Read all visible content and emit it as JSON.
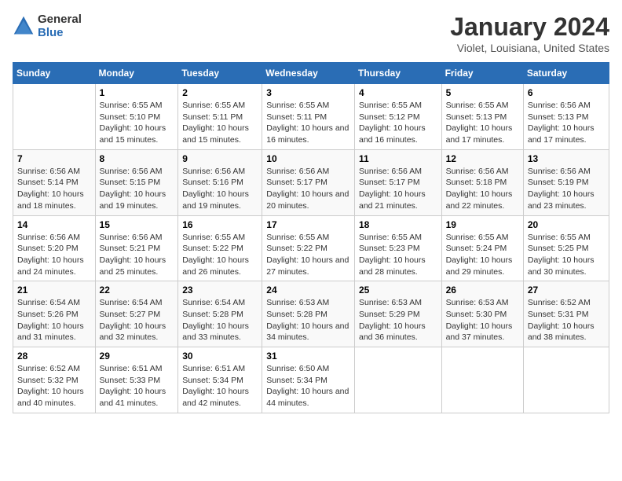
{
  "logo": {
    "line1": "General",
    "line2": "Blue"
  },
  "title": "January 2024",
  "subtitle": "Violet, Louisiana, United States",
  "weekdays": [
    "Sunday",
    "Monday",
    "Tuesday",
    "Wednesday",
    "Thursday",
    "Friday",
    "Saturday"
  ],
  "weeks": [
    [
      {
        "day": "",
        "sunrise": "",
        "sunset": "",
        "daylight": ""
      },
      {
        "day": "1",
        "sunrise": "Sunrise: 6:55 AM",
        "sunset": "Sunset: 5:10 PM",
        "daylight": "Daylight: 10 hours and 15 minutes."
      },
      {
        "day": "2",
        "sunrise": "Sunrise: 6:55 AM",
        "sunset": "Sunset: 5:11 PM",
        "daylight": "Daylight: 10 hours and 15 minutes."
      },
      {
        "day": "3",
        "sunrise": "Sunrise: 6:55 AM",
        "sunset": "Sunset: 5:11 PM",
        "daylight": "Daylight: 10 hours and 16 minutes."
      },
      {
        "day": "4",
        "sunrise": "Sunrise: 6:55 AM",
        "sunset": "Sunset: 5:12 PM",
        "daylight": "Daylight: 10 hours and 16 minutes."
      },
      {
        "day": "5",
        "sunrise": "Sunrise: 6:55 AM",
        "sunset": "Sunset: 5:13 PM",
        "daylight": "Daylight: 10 hours and 17 minutes."
      },
      {
        "day": "6",
        "sunrise": "Sunrise: 6:56 AM",
        "sunset": "Sunset: 5:13 PM",
        "daylight": "Daylight: 10 hours and 17 minutes."
      }
    ],
    [
      {
        "day": "7",
        "sunrise": "Sunrise: 6:56 AM",
        "sunset": "Sunset: 5:14 PM",
        "daylight": "Daylight: 10 hours and 18 minutes."
      },
      {
        "day": "8",
        "sunrise": "Sunrise: 6:56 AM",
        "sunset": "Sunset: 5:15 PM",
        "daylight": "Daylight: 10 hours and 19 minutes."
      },
      {
        "day": "9",
        "sunrise": "Sunrise: 6:56 AM",
        "sunset": "Sunset: 5:16 PM",
        "daylight": "Daylight: 10 hours and 19 minutes."
      },
      {
        "day": "10",
        "sunrise": "Sunrise: 6:56 AM",
        "sunset": "Sunset: 5:17 PM",
        "daylight": "Daylight: 10 hours and 20 minutes."
      },
      {
        "day": "11",
        "sunrise": "Sunrise: 6:56 AM",
        "sunset": "Sunset: 5:17 PM",
        "daylight": "Daylight: 10 hours and 21 minutes."
      },
      {
        "day": "12",
        "sunrise": "Sunrise: 6:56 AM",
        "sunset": "Sunset: 5:18 PM",
        "daylight": "Daylight: 10 hours and 22 minutes."
      },
      {
        "day": "13",
        "sunrise": "Sunrise: 6:56 AM",
        "sunset": "Sunset: 5:19 PM",
        "daylight": "Daylight: 10 hours and 23 minutes."
      }
    ],
    [
      {
        "day": "14",
        "sunrise": "Sunrise: 6:56 AM",
        "sunset": "Sunset: 5:20 PM",
        "daylight": "Daylight: 10 hours and 24 minutes."
      },
      {
        "day": "15",
        "sunrise": "Sunrise: 6:56 AM",
        "sunset": "Sunset: 5:21 PM",
        "daylight": "Daylight: 10 hours and 25 minutes."
      },
      {
        "day": "16",
        "sunrise": "Sunrise: 6:55 AM",
        "sunset": "Sunset: 5:22 PM",
        "daylight": "Daylight: 10 hours and 26 minutes."
      },
      {
        "day": "17",
        "sunrise": "Sunrise: 6:55 AM",
        "sunset": "Sunset: 5:22 PM",
        "daylight": "Daylight: 10 hours and 27 minutes."
      },
      {
        "day": "18",
        "sunrise": "Sunrise: 6:55 AM",
        "sunset": "Sunset: 5:23 PM",
        "daylight": "Daylight: 10 hours and 28 minutes."
      },
      {
        "day": "19",
        "sunrise": "Sunrise: 6:55 AM",
        "sunset": "Sunset: 5:24 PM",
        "daylight": "Daylight: 10 hours and 29 minutes."
      },
      {
        "day": "20",
        "sunrise": "Sunrise: 6:55 AM",
        "sunset": "Sunset: 5:25 PM",
        "daylight": "Daylight: 10 hours and 30 minutes."
      }
    ],
    [
      {
        "day": "21",
        "sunrise": "Sunrise: 6:54 AM",
        "sunset": "Sunset: 5:26 PM",
        "daylight": "Daylight: 10 hours and 31 minutes."
      },
      {
        "day": "22",
        "sunrise": "Sunrise: 6:54 AM",
        "sunset": "Sunset: 5:27 PM",
        "daylight": "Daylight: 10 hours and 32 minutes."
      },
      {
        "day": "23",
        "sunrise": "Sunrise: 6:54 AM",
        "sunset": "Sunset: 5:28 PM",
        "daylight": "Daylight: 10 hours and 33 minutes."
      },
      {
        "day": "24",
        "sunrise": "Sunrise: 6:53 AM",
        "sunset": "Sunset: 5:28 PM",
        "daylight": "Daylight: 10 hours and 34 minutes."
      },
      {
        "day": "25",
        "sunrise": "Sunrise: 6:53 AM",
        "sunset": "Sunset: 5:29 PM",
        "daylight": "Daylight: 10 hours and 36 minutes."
      },
      {
        "day": "26",
        "sunrise": "Sunrise: 6:53 AM",
        "sunset": "Sunset: 5:30 PM",
        "daylight": "Daylight: 10 hours and 37 minutes."
      },
      {
        "day": "27",
        "sunrise": "Sunrise: 6:52 AM",
        "sunset": "Sunset: 5:31 PM",
        "daylight": "Daylight: 10 hours and 38 minutes."
      }
    ],
    [
      {
        "day": "28",
        "sunrise": "Sunrise: 6:52 AM",
        "sunset": "Sunset: 5:32 PM",
        "daylight": "Daylight: 10 hours and 40 minutes."
      },
      {
        "day": "29",
        "sunrise": "Sunrise: 6:51 AM",
        "sunset": "Sunset: 5:33 PM",
        "daylight": "Daylight: 10 hours and 41 minutes."
      },
      {
        "day": "30",
        "sunrise": "Sunrise: 6:51 AM",
        "sunset": "Sunset: 5:34 PM",
        "daylight": "Daylight: 10 hours and 42 minutes."
      },
      {
        "day": "31",
        "sunrise": "Sunrise: 6:50 AM",
        "sunset": "Sunset: 5:34 PM",
        "daylight": "Daylight: 10 hours and 44 minutes."
      },
      {
        "day": "",
        "sunrise": "",
        "sunset": "",
        "daylight": ""
      },
      {
        "day": "",
        "sunrise": "",
        "sunset": "",
        "daylight": ""
      },
      {
        "day": "",
        "sunrise": "",
        "sunset": "",
        "daylight": ""
      }
    ]
  ]
}
